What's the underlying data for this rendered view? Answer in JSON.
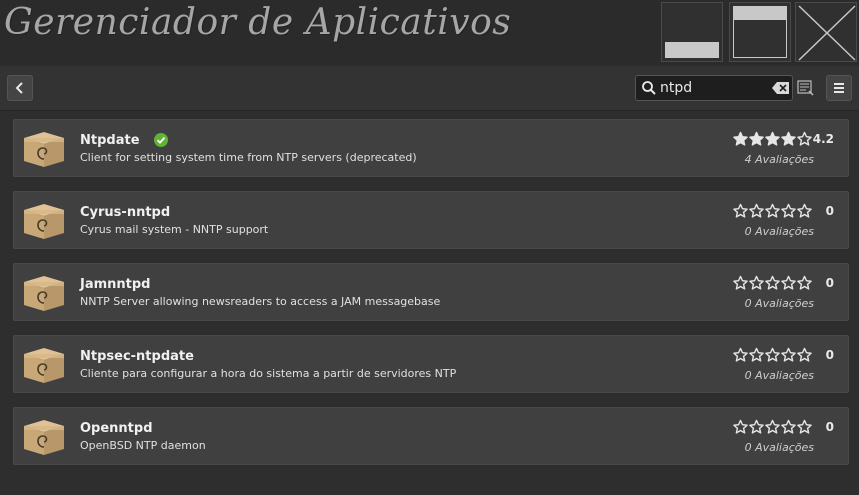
{
  "window": {
    "title": "Gerenciador de Aplicativos"
  },
  "toolbar": {
    "search_value": "ntpd"
  },
  "apps": [
    {
      "name": "Ntpdate",
      "description": "Client for setting system time from NTP servers (deprecated)",
      "rating": "4.2",
      "stars_filled": 4.2,
      "reviews": "4 Avaliações",
      "installed": true
    },
    {
      "name": "Cyrus-nntpd",
      "description": "Cyrus mail system - NNTP support",
      "rating": "0",
      "stars_filled": 0,
      "reviews": "0 Avaliações",
      "installed": false
    },
    {
      "name": "Jamnntpd",
      "description": "NNTP Server allowing newsreaders to access a JAM messagebase",
      "rating": "0",
      "stars_filled": 0,
      "reviews": "0 Avaliações",
      "installed": false
    },
    {
      "name": "Ntpsec-ntpdate",
      "description": "Cliente para configurar a hora do sistema a partir de servidores NTP",
      "rating": "0",
      "stars_filled": 0,
      "reviews": "0 Avaliações",
      "installed": false
    },
    {
      "name": "Openntpd",
      "description": "OpenBSD NTP daemon",
      "rating": "0",
      "stars_filled": 0,
      "reviews": "0 Avaliações",
      "installed": false
    }
  ],
  "colors": {
    "background": "#2e2e2e",
    "row_background": "#404040",
    "installed_check": "#5fb434",
    "package_box": "#c9a878"
  },
  "icons": {
    "back": "chevron-left-icon",
    "search": "search-icon",
    "clear": "clear-icon",
    "list": "list-icon",
    "menu": "hamburger-menu-icon",
    "package": "package-icon",
    "installed": "checkmark-icon",
    "star": "star-icon"
  }
}
